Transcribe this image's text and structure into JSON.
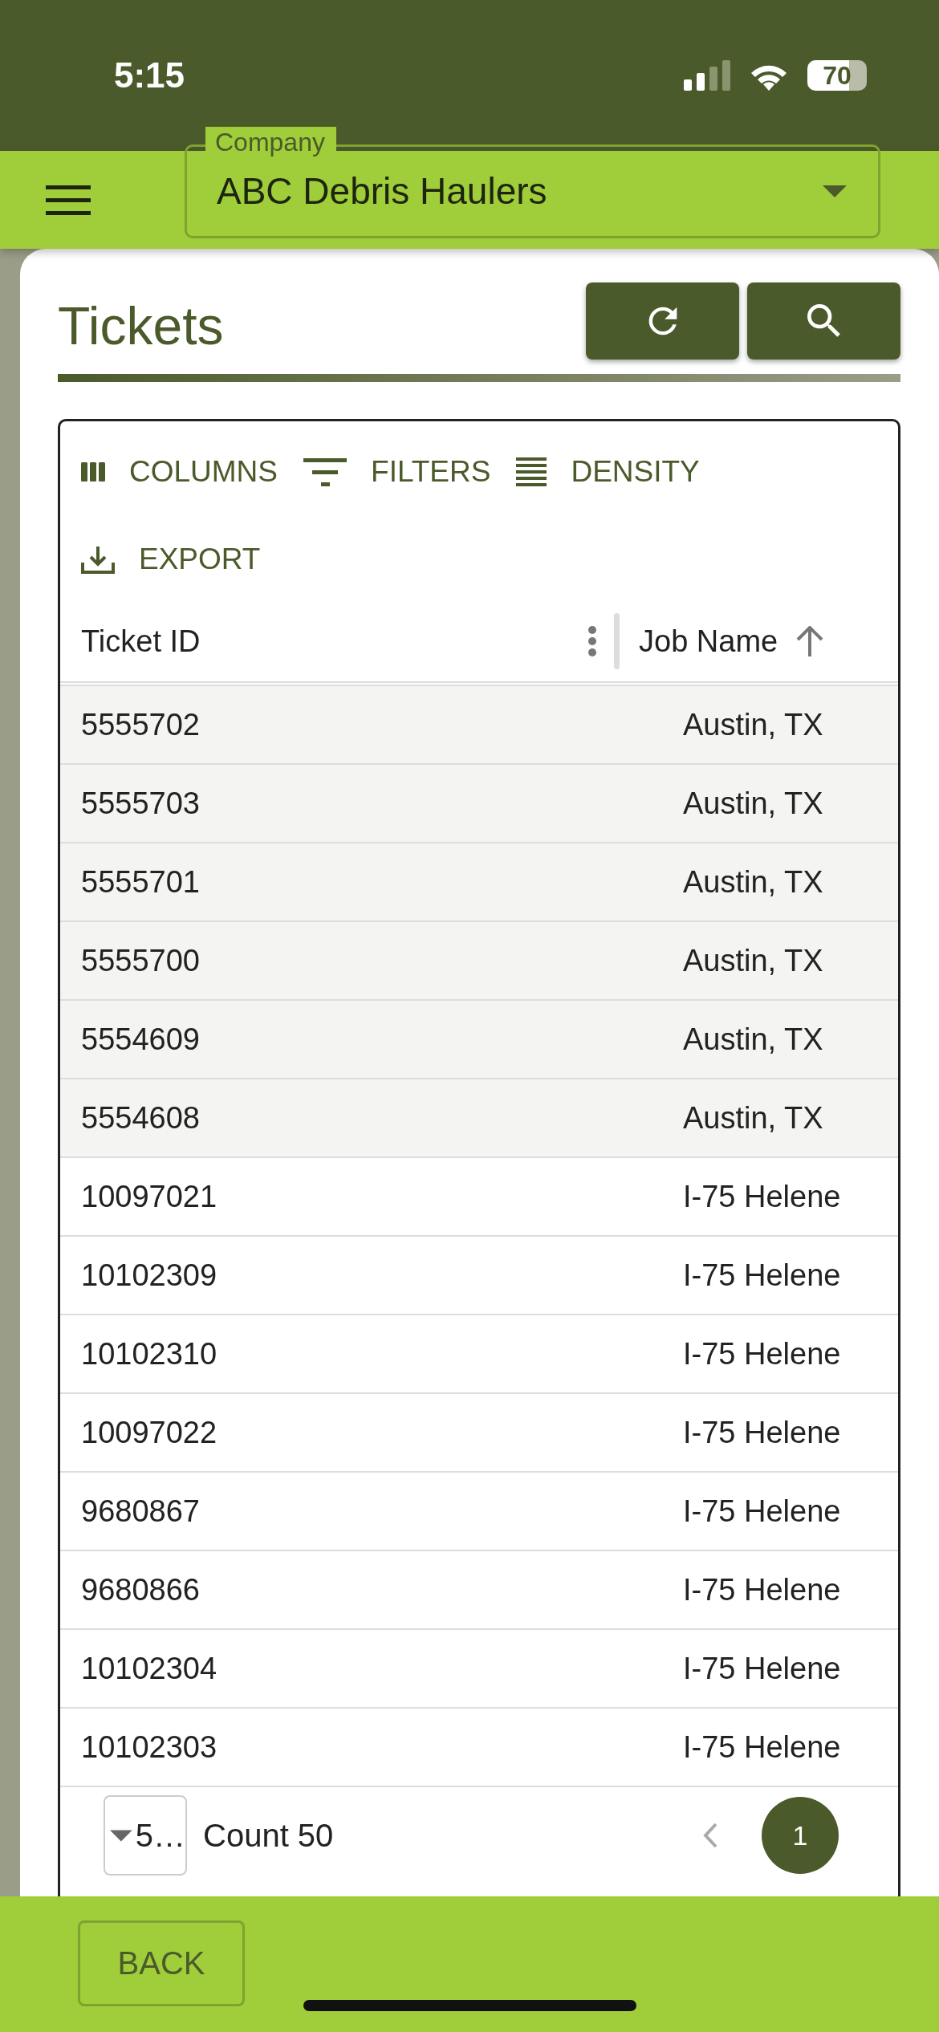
{
  "status_bar": {
    "time": "5:15",
    "battery": "70"
  },
  "app_bar": {
    "company_select": {
      "label": "Company",
      "value": "ABC Debris Haulers"
    }
  },
  "page": {
    "title": "Tickets"
  },
  "toolbar": [
    {
      "kind": "columns",
      "label": "COLUMNS"
    },
    {
      "kind": "filters",
      "label": "FILTERS"
    },
    {
      "kind": "density",
      "label": "DENSITY"
    },
    {
      "kind": "export",
      "label": "EXPORT"
    }
  ],
  "table": {
    "columns": [
      {
        "label": "Ticket ID",
        "menu_visible": true,
        "sorted_ascending": false
      },
      {
        "label": "Job Name",
        "menu_visible": false,
        "sorted_ascending": true
      }
    ],
    "rows": [
      {
        "ticket_id": "5555702",
        "job_name": "Austin, TX",
        "highlighted": true
      },
      {
        "ticket_id": "5555703",
        "job_name": "Austin, TX",
        "highlighted": true
      },
      {
        "ticket_id": "5555701",
        "job_name": "Austin, TX",
        "highlighted": true
      },
      {
        "ticket_id": "5555700",
        "job_name": "Austin, TX",
        "highlighted": true
      },
      {
        "ticket_id": "5554609",
        "job_name": "Austin, TX",
        "highlighted": true
      },
      {
        "ticket_id": "5554608",
        "job_name": "Austin, TX",
        "highlighted": true
      },
      {
        "ticket_id": "10097021",
        "job_name": "I-75 Helene",
        "highlighted": false
      },
      {
        "ticket_id": "10102309",
        "job_name": "I-75 Helene",
        "highlighted": false
      },
      {
        "ticket_id": "10102310",
        "job_name": "I-75 Helene",
        "highlighted": false
      },
      {
        "ticket_id": "10097022",
        "job_name": "I-75 Helene",
        "highlighted": false
      },
      {
        "ticket_id": "9680867",
        "job_name": "I-75 Helene",
        "highlighted": false
      },
      {
        "ticket_id": "9680866",
        "job_name": "I-75 Helene",
        "highlighted": false
      },
      {
        "ticket_id": "10102304",
        "job_name": "I-75 Helene",
        "highlighted": false
      },
      {
        "ticket_id": "10102303",
        "job_name": "I-75 Helene",
        "highlighted": false
      }
    ]
  },
  "pagination": {
    "rows_per_page": "5…",
    "count": "Count 50",
    "page": "1"
  },
  "footer": {
    "back_button": "BACK"
  }
}
